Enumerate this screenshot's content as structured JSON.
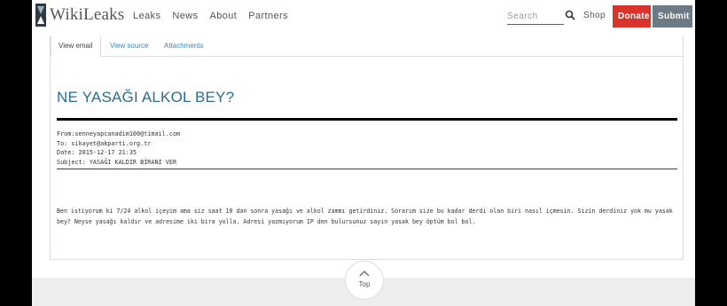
{
  "header": {
    "logo_text": "WikiLeaks",
    "nav": [
      "Leaks",
      "News",
      "About",
      "Partners"
    ],
    "search_placeholder": "Search",
    "shop_label": "Shop",
    "donate_label": "Donate",
    "submit_label": "Submit",
    "colors": {
      "donate": "#d9342b",
      "submit": "#6c7a85",
      "accent": "#2a6e8f"
    }
  },
  "tabs": [
    "View email",
    "View source",
    "Attachments"
  ],
  "email": {
    "title": "NE YASAĞI ALKOL BEY?",
    "from": "From:senneyapcanadim100@timail.com",
    "to": "To: sikayet@akparti.org.tr",
    "date": "Date: 2015-12-17 21:35",
    "subject": "Subject: YASAĞI KALDIR BİRANI VER",
    "body": "Ben istiyorum ki 7/24 alkol içeyim ama siz saat 10 dan sonra yasağı ve alkol zammı getirdiniz. Sorarım size bu kadar derdi olan biri nasıl içmesin. Sizin derdiniz yok mu yasak bey? Neyse yasağı kaldır ve adresime iki bira yolla. Adresi yazmıyorum IP den bulursunuz sayın yasak bey öptüm bol bol."
  },
  "footer": {
    "top_label": "Top"
  }
}
